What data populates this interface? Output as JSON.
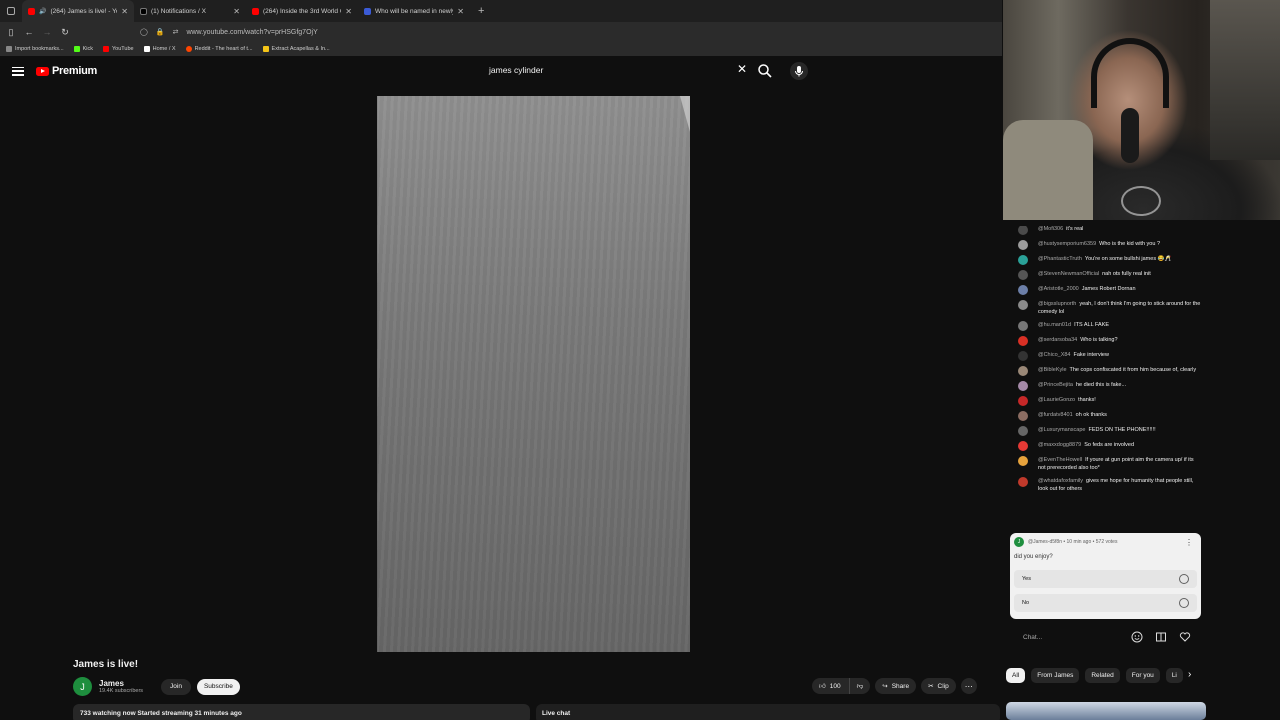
{
  "browser": {
    "tabs": [
      {
        "title": "(264) James is live! - YouTu",
        "color": "#ff0000",
        "active": true
      },
      {
        "title": "(1) Notifications / X",
        "color": "#000000",
        "active": false
      },
      {
        "title": "(264) Inside the 3rd World City",
        "color": "#ff0000",
        "active": false
      },
      {
        "title": "Who will be named in newly re",
        "color": "#3b5bd6",
        "active": false
      }
    ],
    "url": "www.youtube.com/watch?v=prHSGfg7OjY",
    "bookmarks": [
      "Import bookmarks...",
      "Kick",
      "YouTube",
      "Home / X",
      "Reddit - The heart of t...",
      "Extract Acapellas & In..."
    ]
  },
  "youtube": {
    "logo_text": "Premium",
    "search_value": "james cylinder",
    "video_title": "James is live!",
    "channel": {
      "name": "James",
      "subscribers": "19.4K subscribers",
      "avatar_letter": "J"
    },
    "join_label": "Join",
    "subscribe_label": "Subscribe",
    "like_count": "100",
    "share_label": "Share",
    "clip_label": "Clip",
    "description": "733 watching now  Started streaming 31 minutes ago",
    "livechat_label": "Live chat"
  },
  "chat": {
    "messages": [
      {
        "author": "@Mofi306",
        "text": "it's real",
        "color": "#4a4a4a"
      },
      {
        "author": "@hustysemporium6359",
        "text": "Who is the kid with you ?",
        "color": "#9c9c9c"
      },
      {
        "author": "@PhantasticTruth",
        "text": "You're on some bullshi james 😂🥂",
        "color": "#2aa198"
      },
      {
        "author": "@StevenNewmanOfficial",
        "text": "nah ots fully real init",
        "color": "#555555"
      },
      {
        "author": "@Aristotle_2000",
        "text": "James Robert Dornan",
        "color": "#6c7fa8"
      },
      {
        "author": "@bigsslupnorth",
        "text": "yeah, I don't think I'm going to stick around for the comedy lol",
        "color": "#8a8a8a"
      },
      {
        "author": "@hu.man01d",
        "text": "ITS ALL FAKE",
        "color": "#777777"
      },
      {
        "author": "@serdarsoba34",
        "text": "Who is talking?",
        "color": "#d93025"
      },
      {
        "author": "@Chico_X84",
        "text": "Fake interview",
        "color": "#333333"
      },
      {
        "author": "@BibleKyle",
        "text": "The cops confiscated it from him because of, clearly",
        "color": "#9a8877"
      },
      {
        "author": "@PrinceBejita",
        "text": "he died this is fake...",
        "color": "#a58aa8"
      },
      {
        "author": "@LaurieGonzo",
        "text": "thanks!",
        "color": "#c62828"
      },
      {
        "author": "@furdatv8401",
        "text": "oh ok thanks",
        "color": "#8c6d62"
      },
      {
        "author": "@Luxurymanscape",
        "text": "FEDS ON THE PHONE!!!!!!",
        "color": "#666666"
      },
      {
        "author": "@maxxdogg8879",
        "text": "So feds are involved",
        "color": "#e53935"
      },
      {
        "author": "@EvenTheHowell",
        "text": "If youre at gun point aim the camera up/ if its not prerecorded also too*",
        "color": "#e6a23c"
      },
      {
        "author": "@whatdafoxfamily",
        "text": "gives me hope for humanity that people still, look out for others",
        "color": "#c0392b"
      }
    ],
    "poll": {
      "author_line": "@James-d5f8n • 10 min ago • 572 votes",
      "question": "did you enjoy?",
      "options": [
        "Yes",
        "No"
      ]
    },
    "input_placeholder": "Chat..."
  },
  "chips": [
    "All",
    "From James",
    "Related",
    "For you",
    "Li"
  ]
}
